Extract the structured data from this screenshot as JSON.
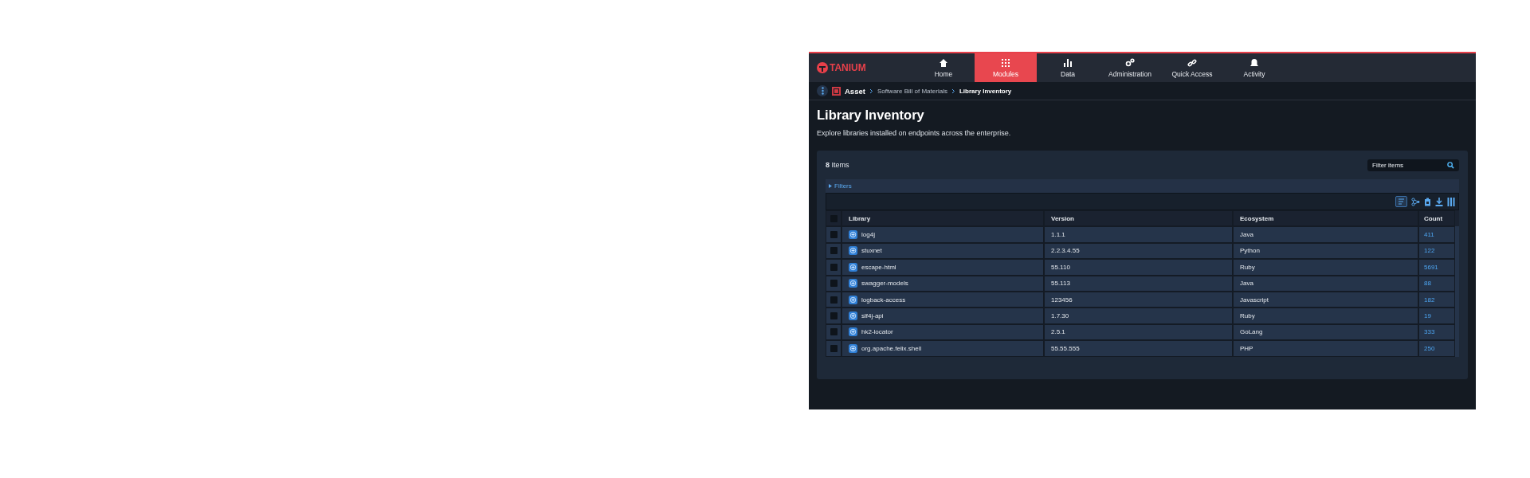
{
  "app": {
    "logo": "TANIUM",
    "nav": [
      {
        "label": "Home",
        "kind": "home",
        "selected": false
      },
      {
        "label": "Modules",
        "kind": "grid",
        "selected": true
      },
      {
        "label": "Data",
        "kind": "bars",
        "selected": false
      },
      {
        "label": "Administration",
        "kind": "gears",
        "selected": false
      },
      {
        "label": "Quick Access",
        "kind": "link",
        "selected": false
      },
      {
        "label": "Activity",
        "kind": "bell",
        "selected": false
      }
    ],
    "breadcrumb": {
      "module": "Asset",
      "path": [
        "Software Bill of Materials",
        "Library Inventory"
      ]
    },
    "title": "Library Inventory",
    "description": "Explore libraries installed on endpoints across the enterprise.",
    "panel": {
      "count": "**8** Items",
      "filter": {
        "placeholder": "Filter items"
      },
      "filters_label": "Filters",
      "table": {
        "select_all_checked": false,
        "columns": [
          "Library",
          "Version",
          "Ecosystem",
          "Count"
        ],
        "rows": [
          {
            "library": "log4j",
            "version": "1.1.1",
            "ecosystem": "Java",
            "count": "411",
            "checked": false
          },
          {
            "library": "stuxnet",
            "version": "2.2.3.4.55",
            "ecosystem": "Python",
            "count": "122",
            "checked": false
          },
          {
            "library": "escape-html",
            "version": "55.110",
            "ecosystem": "Ruby",
            "count": "5691",
            "checked": false
          },
          {
            "library": "swagger-models",
            "version": "55.113",
            "ecosystem": "Java",
            "count": "88",
            "checked": false
          },
          {
            "library": "logback-access",
            "version": "123456",
            "ecosystem": "Javascript",
            "count": "182",
            "checked": false
          },
          {
            "library": "slf4j-api",
            "version": "1.7.30",
            "ecosystem": "Ruby",
            "count": "19",
            "checked": false
          },
          {
            "library": "hk2-locator",
            "version": "2.5.1",
            "ecosystem": "GoLang",
            "count": "333",
            "checked": false
          },
          {
            "library": "org.apache.felix.shell",
            "version": "55.55.555",
            "ecosystem": "PHP",
            "count": "250",
            "checked": false
          }
        ]
      }
    }
  }
}
